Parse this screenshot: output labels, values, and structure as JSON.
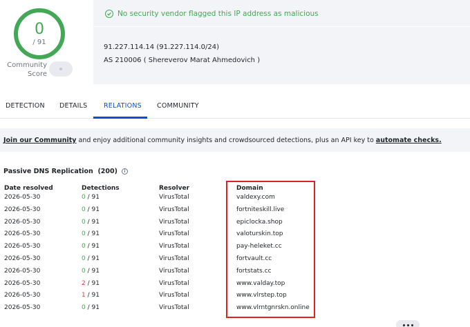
{
  "score": {
    "detections": "0",
    "total": "/ 91",
    "community_label": "Community\nScore"
  },
  "header": {
    "alert": "No security vendor flagged this IP address as malicious",
    "ip": "91.227.114.14  (91.227.114.0/24)",
    "as": "AS 210006  ( Shereverov Marat Ahmedovich )"
  },
  "tabs": [
    {
      "label": "DETECTION"
    },
    {
      "label": "DETAILS"
    },
    {
      "label": "RELATIONS"
    },
    {
      "label": "COMMUNITY"
    }
  ],
  "banner": {
    "join": "Join our Community",
    "middle": " and enjoy additional community insights and crowdsourced detections, plus an API key to ",
    "link": "automate checks."
  },
  "pdns": {
    "title": "Passive DNS Replication",
    "count": "(200)",
    "headers": [
      "Date resolved",
      "Detections",
      "Resolver",
      "Domain"
    ],
    "rows": [
      {
        "date": "2026-05-30",
        "det": "0",
        "total": " / 91",
        "resolver": "VirusTotal",
        "domain": "valdexy.com"
      },
      {
        "date": "2026-05-30",
        "det": "0",
        "total": " / 91",
        "resolver": "VirusTotal",
        "domain": "fortniteskill.live"
      },
      {
        "date": "2026-05-30",
        "det": "0",
        "total": " / 91",
        "resolver": "VirusTotal",
        "domain": "epiclocka.shop"
      },
      {
        "date": "2026-05-30",
        "det": "0",
        "total": " / 91",
        "resolver": "VirusTotal",
        "domain": "valoturskin.top"
      },
      {
        "date": "2026-05-30",
        "det": "0",
        "total": " / 91",
        "resolver": "VirusTotal",
        "domain": "pay-heleket.cc"
      },
      {
        "date": "2026-05-30",
        "det": "0",
        "total": " / 91",
        "resolver": "VirusTotal",
        "domain": "fortvault.cc"
      },
      {
        "date": "2026-05-30",
        "det": "0",
        "total": " / 91",
        "resolver": "VirusTotal",
        "domain": "fortstats.cc"
      },
      {
        "date": "2026-05-30",
        "det": "2",
        "total": " / 91",
        "resolver": "VirusTotal",
        "domain": "www.valday.top"
      },
      {
        "date": "2026-05-30",
        "det": "1",
        "total": " / 91",
        "resolver": "VirusTotal",
        "domain": "www.vlrstep.top"
      },
      {
        "date": "2026-05-30",
        "det": "0",
        "total": " / 91",
        "resolver": "VirusTotal",
        "domain": "www.vlrntgnrskn.online"
      }
    ]
  },
  "colors": {
    "clean": "#43a856",
    "malicious": "#e03c31",
    "accent": "#0b4dda",
    "highlight": "#e0221f"
  }
}
